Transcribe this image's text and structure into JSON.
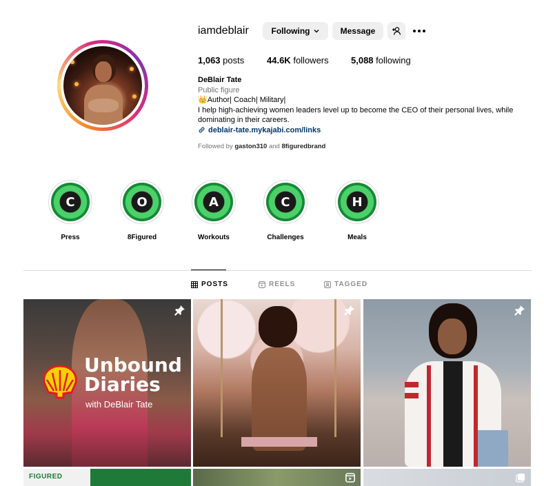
{
  "profile": {
    "username": "iamdeblair",
    "following_btn": "Following",
    "message_btn": "Message",
    "posts_count": "1,063",
    "posts_label": "posts",
    "followers_count": "44.6K",
    "followers_label": "followers",
    "following_count": "5,088",
    "following_label": "following",
    "name": "DeBlair Tate",
    "category": "Public figure",
    "bio_line1": "👑Author| Coach| Military|",
    "bio_line2": "I help high-achieving women leaders level up to become the CEO of their personal lives, while dominating in their careers.",
    "link": "deblair-tate.mykajabi.com/links",
    "followed_by_prefix": "Followed by",
    "followed_by_user1": "gaston310",
    "followed_by_and": "and",
    "followed_by_user2": "8figuredbrand"
  },
  "highlights": [
    {
      "letter": "C",
      "label": "Press"
    },
    {
      "letter": "O",
      "label": "8Figured"
    },
    {
      "letter": "A",
      "label": "Workouts"
    },
    {
      "letter": "C",
      "label": "Challenges"
    },
    {
      "letter": "H",
      "label": "Meals"
    }
  ],
  "tabs": {
    "posts": "POSTS",
    "reels": "REELS",
    "tagged": "TAGGED"
  },
  "posts": {
    "post1_title_line1": "Unbound",
    "post1_title_line2": "Diaries",
    "post1_subtitle": "with DeBlair Tate",
    "row2_label": "FIGURED"
  },
  "colors": {
    "link": "#00376b",
    "highlight_green": "#4cd06a",
    "button_bg": "#efefef"
  }
}
